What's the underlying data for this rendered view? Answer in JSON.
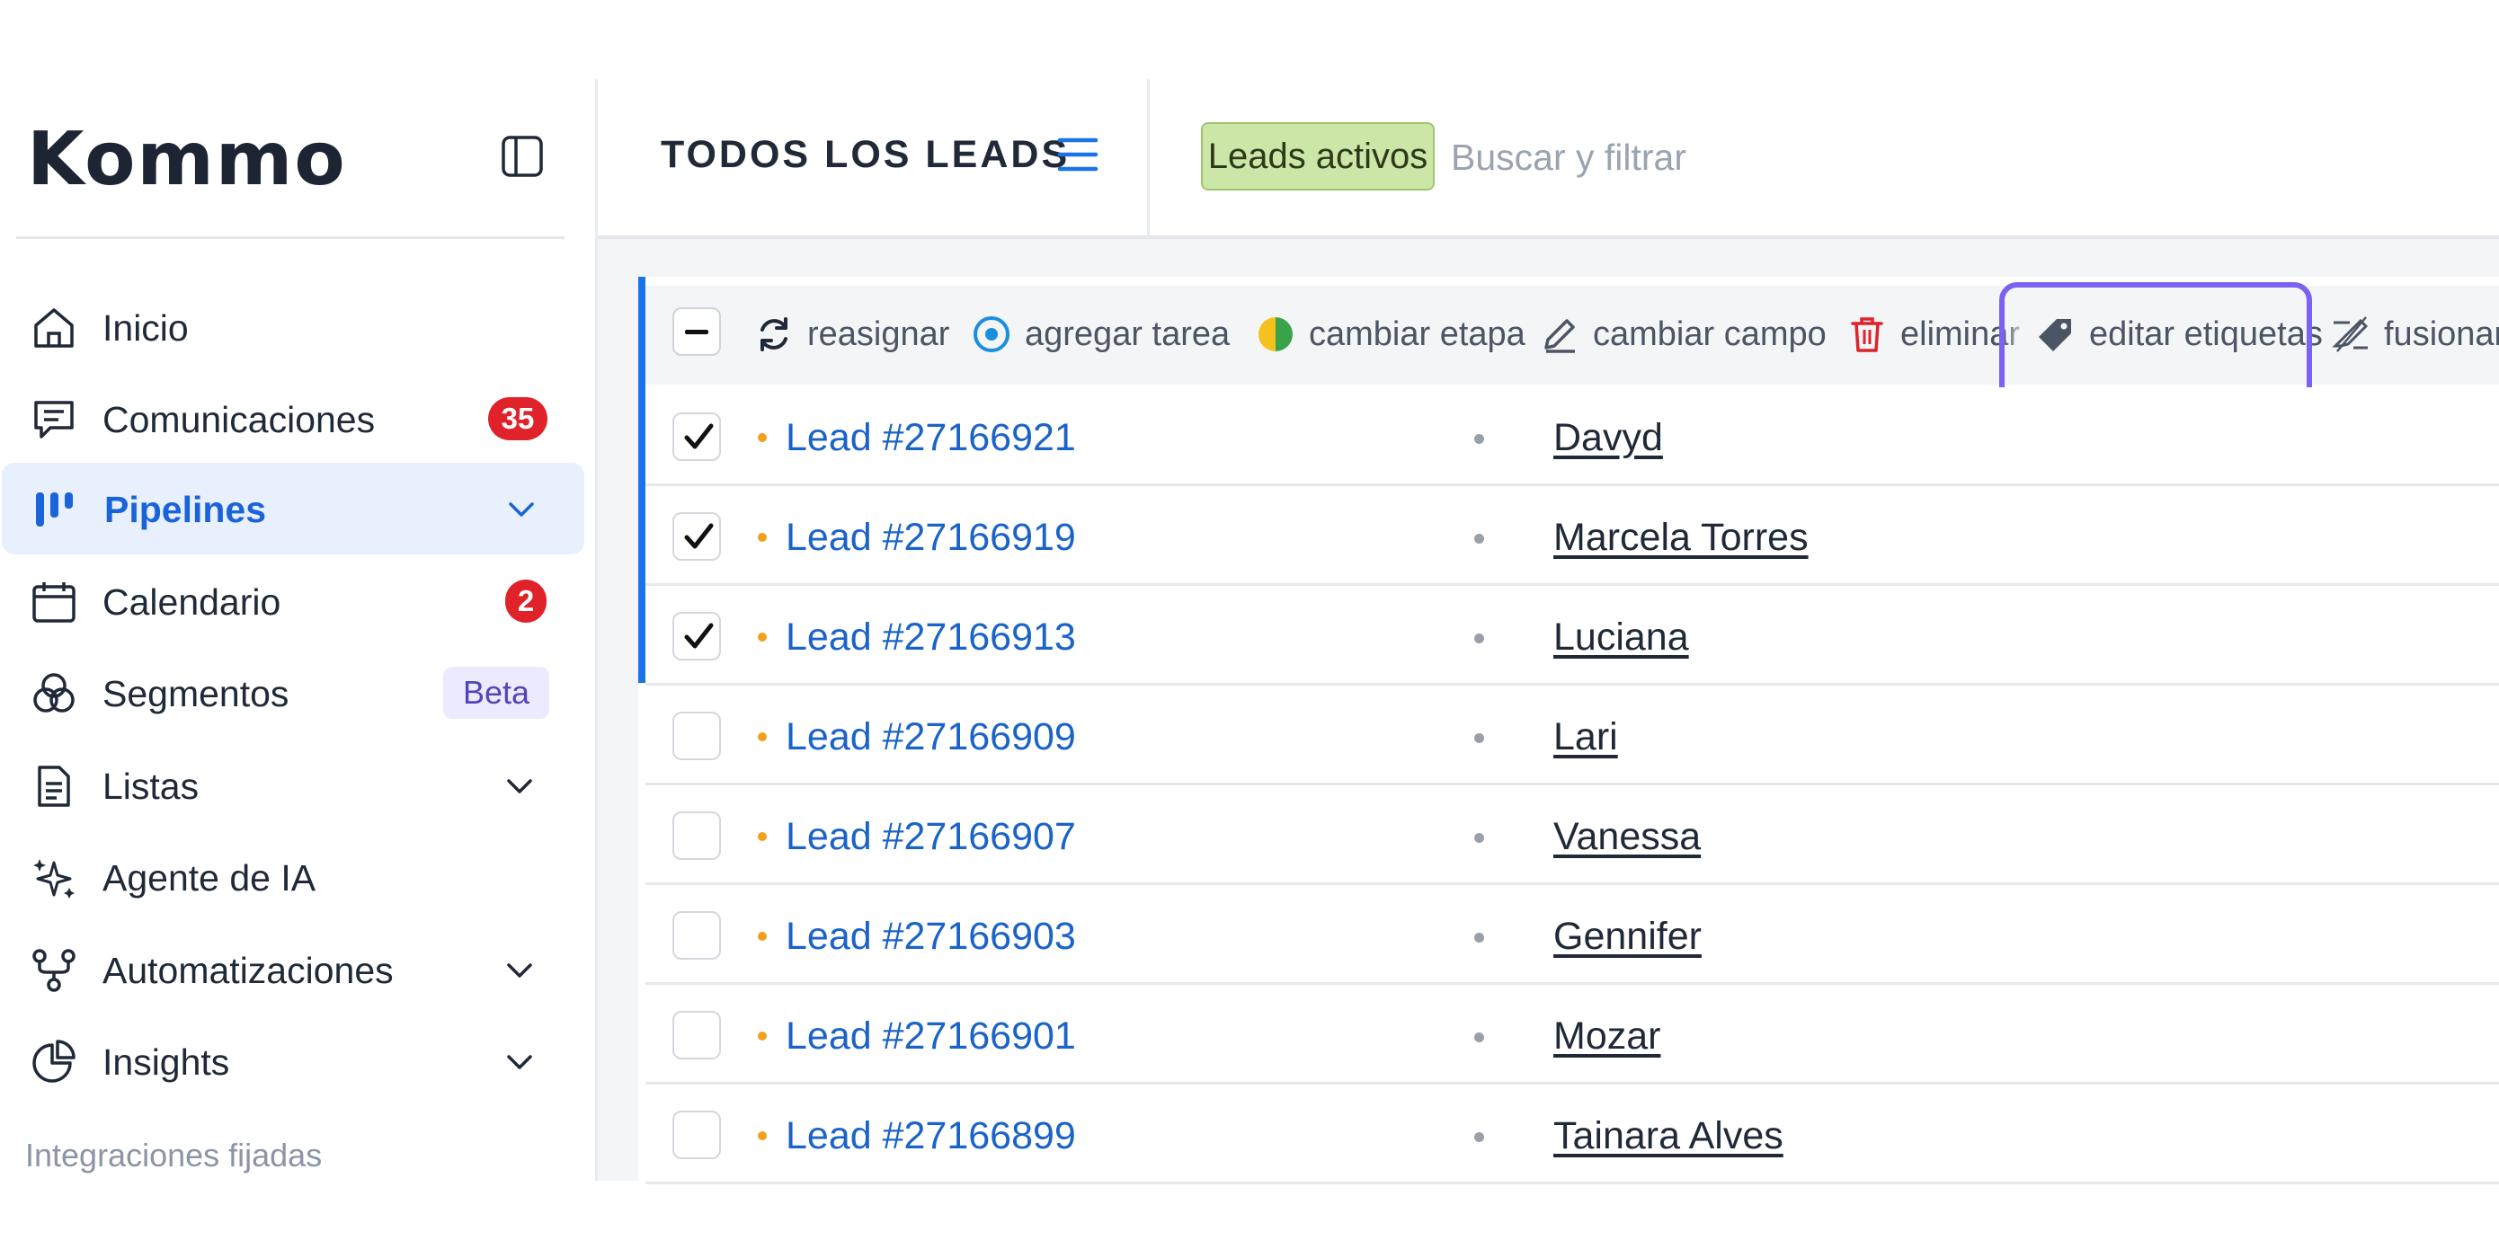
{
  "brand": {
    "logo_text": "Kommo"
  },
  "sidebar": {
    "items": [
      {
        "label": "Inicio",
        "icon": "home-icon"
      },
      {
        "label": "Comunicaciones",
        "icon": "chat-icon",
        "badge": "35"
      },
      {
        "label": "Pipelines",
        "icon": "pipeline-icon",
        "active": true
      },
      {
        "label": "Calendario",
        "icon": "calendar-icon",
        "badge": "2"
      },
      {
        "label": "Segmentos",
        "icon": "segments-icon",
        "tag": "Beta"
      },
      {
        "label": "Listas",
        "icon": "document-icon"
      },
      {
        "label": "Agente de IA",
        "icon": "sparkles-icon"
      },
      {
        "label": "Automatizaciones",
        "icon": "automation-icon"
      },
      {
        "label": "Insights",
        "icon": "pie-chart-icon"
      }
    ],
    "pinned_label": "Integraciones fijadas"
  },
  "header": {
    "title": "TODOS LOS LEADS",
    "filter_chip": "Leads activos",
    "search_placeholder": "Buscar y filtrar"
  },
  "toolbar": {
    "actions": [
      {
        "label": "reasignar",
        "icon": "refresh-icon"
      },
      {
        "label": "agregar tarea",
        "icon": "target-icon"
      },
      {
        "label": "cambiar etapa",
        "icon": "half-circle-icon"
      },
      {
        "label": "cambiar campo",
        "icon": "pencil-icon"
      },
      {
        "label": "eliminar",
        "icon": "trash-icon"
      },
      {
        "label": "editar etiquetas",
        "icon": "tag-icon"
      },
      {
        "label": "fusionar",
        "icon": "merge-icon"
      }
    ]
  },
  "leads": [
    {
      "lead": "Lead #27166921",
      "contact": "Davyd",
      "checked": true
    },
    {
      "lead": "Lead #27166919",
      "contact": "Marcela Torres",
      "checked": true
    },
    {
      "lead": "Lead #27166913",
      "contact": "Luciana",
      "checked": true
    },
    {
      "lead": "Lead #27166909",
      "contact": "Lari",
      "checked": false
    },
    {
      "lead": "Lead #27166907",
      "contact": "Vanessa",
      "checked": false
    },
    {
      "lead": "Lead #27166903",
      "contact": "Gennifer",
      "checked": false
    },
    {
      "lead": "Lead #27166901",
      "contact": "Mozar",
      "checked": false
    },
    {
      "lead": "Lead #27166899",
      "contact": "Tainara Alves",
      "checked": false
    }
  ],
  "colors": {
    "accent_blue": "#1a63d9",
    "badge_red": "#e0222a",
    "filter_green": "#cce6a8",
    "highlight_purple": "#7b62f0",
    "lead_dot_orange": "#f2a019"
  }
}
